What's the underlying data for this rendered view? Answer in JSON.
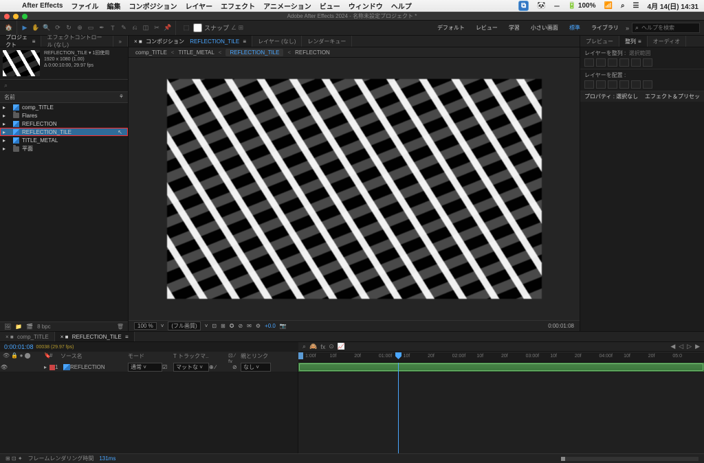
{
  "mac": {
    "apple": "",
    "app": "After Effects",
    "menus": [
      "ファイル",
      "編集",
      "コンポジション",
      "レイヤー",
      "エフェクト",
      "アニメーション",
      "ビュー",
      "ウィンドウ",
      "ヘルプ"
    ],
    "right": {
      "battery": "100%",
      "date": "4月 14(日) 14:31"
    },
    "badge": "A"
  },
  "window_title": "Adobe After Effects 2024 - 名称未設定プロジェクト *",
  "toolbar": {
    "snap": "スナップ",
    "ws": [
      "デフォルト",
      "レビュー",
      "学習",
      "小さい画面",
      "標準",
      "ライブラリ"
    ],
    "active_ws": "標準",
    "search_ph": "ヘルプを検索"
  },
  "project": {
    "tab": "プロジェクト",
    "tab2": "エフェクトコントロール (なし)",
    "comp_title": "REFLECTION_TILE ▾ 1回使用",
    "comp_meta1": "1920 x 1080 (1.00)",
    "comp_meta2": "Δ 0:00:10:00, 29.97 fps",
    "search": "⌕",
    "col": "名前",
    "items": [
      {
        "type": "comp",
        "label": "comp_TITLE",
        "indent": 1
      },
      {
        "type": "folder",
        "label": "Flares",
        "indent": 1
      },
      {
        "type": "comp",
        "label": "REFLECTION",
        "indent": 1
      },
      {
        "type": "comp",
        "label": "REFLECTION_TILE",
        "indent": 1,
        "hl": true
      },
      {
        "type": "comp",
        "label": "TITLE_METAL",
        "indent": 1
      },
      {
        "type": "folder",
        "label": "平面",
        "indent": 1
      }
    ],
    "footer": "8 bpc"
  },
  "comp_panel": {
    "tab_comp": "コンポジション",
    "comp_name": "REFLECTION_TILE",
    "tab_layer": "レイヤー (なし)",
    "rq": "レンダーキュー",
    "crumb": [
      "comp_TITLE",
      "TITLE_METAL",
      "REFLECTION_TILE",
      "REFLECTION"
    ],
    "crumb_active": 2,
    "foot": {
      "zoom": "100 %",
      "res": "(フル画質)",
      "exp": "+0.0",
      "time": "0:00:01:08"
    }
  },
  "right": {
    "tabs": [
      "プレビュー",
      "整列",
      "オーディオ"
    ],
    "align": "レイヤーを整列 :",
    "align_opt": "選択範囲",
    "dist": "レイヤーを配置 :",
    "prop_lab": "プロパティ : 選択なし",
    "preset_lab": "エフェクト＆プリセッ"
  },
  "timeline": {
    "tabs": [
      {
        "label": "comp_TITLE"
      },
      {
        "label": "REFLECTION_TILE",
        "active": true
      }
    ],
    "time": "0:00:01:08",
    "frame": "00038 (29.97 fps)",
    "cols": {
      "c1": "ソース名",
      "c2": "モード",
      "c3": "T トラックマ..",
      "c4": "親とリンク"
    },
    "layer": {
      "num": "1",
      "name": "REFLECTION",
      "mode": "通常",
      "mat": "マットな",
      "parent": "なし"
    },
    "ruler": [
      "1:00f",
      "10f",
      "20f",
      "01:00f",
      "10f",
      "20f",
      "02:00f",
      "10f",
      "20f",
      "03:00f",
      "10f",
      "20f",
      "04:00f",
      "10f",
      "20f",
      "05:0"
    ],
    "render": "フレームレンダリング時間",
    "render_val": "131ms"
  }
}
